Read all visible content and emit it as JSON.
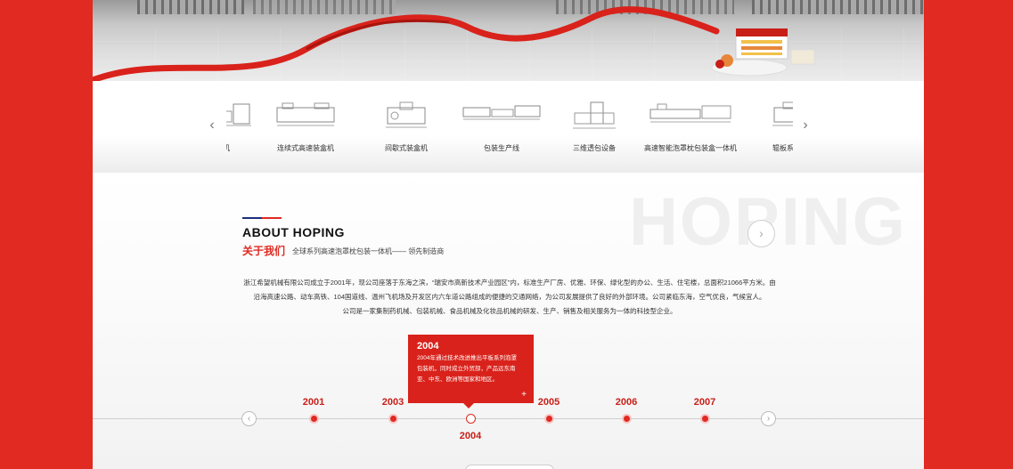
{
  "banner": {
    "ribbon_color": "#d9221b"
  },
  "carousel": {
    "prev_icon": "‹",
    "next_icon": "›",
    "items": [
      {
        "label": "机"
      },
      {
        "label": "连续式高速装盒机"
      },
      {
        "label": "间歇式装盒机"
      },
      {
        "label": "包装生产线"
      },
      {
        "label": "三维透包设备"
      },
      {
        "label": "高速智能泡罩枕包装盒一体机"
      },
      {
        "label": "辊板系列泡罩"
      }
    ]
  },
  "about": {
    "bg_word": "HOPING",
    "en_title": "ABOUT HOPING",
    "cn_title": "关于我们",
    "cn_sub": "全球系列高速泡罩枕包装一体机—— 领先制造商",
    "more_icon": "›",
    "paragraph": [
      "浙江希望机械有限公司成立于2001年，现公司座落于东海之滨，“瑞安市高新技术产业园区”内，标准生产厂房、优雅、环保、绿化型的办公、生活、住宅楼，总面积21066平方米。由",
      "沿海高速公路、动车高铁、104国道线、温州飞机场及开发区内六车道公路组成的便捷的交通网络，为公司发展提供了良好的外部环境。公司紧临东海，空气优良，气候宜人。",
      "公司是一家集制药机械、包装机械、食品机械及化妆品机械的研发、生产、销售及相关服务为一体的科技型企业。"
    ]
  },
  "timeline": {
    "prev_icon": "‹",
    "next_icon": "›",
    "years": [
      "2001",
      "2003",
      "2004",
      "2005",
      "2006",
      "2007"
    ],
    "active_year": "2004",
    "popup": {
      "year": "2004",
      "text_lines": [
        "2004年通过技术改进推出平板系列泡罩",
        "包装机，同时成立外贸部，产品远东南",
        "亚、中东、欧洲等国家和地区。"
      ],
      "plus": "+"
    }
  },
  "colors": {
    "brand_red": "#e02a22",
    "navy": "#1d2f7a"
  }
}
